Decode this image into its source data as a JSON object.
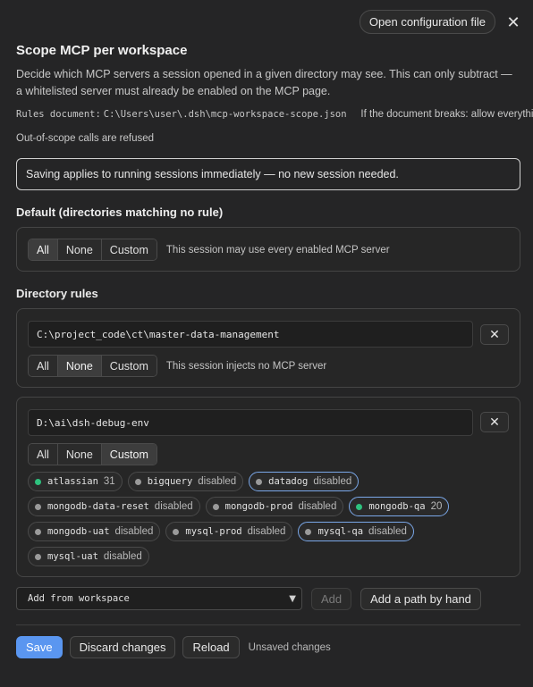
{
  "header": {
    "open_config_label": "Open configuration file",
    "close_glyph": "✕"
  },
  "title": "Scope MCP per workspace",
  "description": "Decide which MCP servers a session opened in a given directory may see. This can only subtract — a whitelisted server must already be enabled on the MCP page.",
  "rules": {
    "document_label": "Rules document:",
    "document_path": "C:\\Users\\user\\.dsh\\mcp-workspace-scope.json",
    "fallback": "If the document breaks: allow everything",
    "refused": "Out-of-scope calls are refused"
  },
  "notice": "Saving applies to running sessions immediately — no new session needed.",
  "default": {
    "heading": "Default (directories matching no rule)",
    "options": [
      "All",
      "None",
      "Custom"
    ],
    "selected": "All",
    "hint": "This session may use every enabled MCP server"
  },
  "rules_section": {
    "heading": "Directory rules",
    "items": [
      {
        "path": "C:\\project_code\\ct\\master-data-management",
        "options": [
          "All",
          "None",
          "Custom"
        ],
        "selected": "None",
        "hint": "This session injects no MCP server"
      },
      {
        "path": "D:\\ai\\dsh-debug-env",
        "options": [
          "All",
          "None",
          "Custom"
        ],
        "selected": "Custom",
        "chips": [
          [
            {
              "name": "atlassian",
              "status": "31",
              "enabled": true,
              "selected": false
            },
            {
              "name": "bigquery",
              "status": "disabled",
              "enabled": false,
              "selected": false
            },
            {
              "name": "datadog",
              "status": "disabled",
              "enabled": false,
              "selected": true
            }
          ],
          [
            {
              "name": "mongodb-data-reset",
              "status": "disabled",
              "enabled": false,
              "selected": false
            },
            {
              "name": "mongodb-prod",
              "status": "disabled",
              "enabled": false,
              "selected": false
            },
            {
              "name": "mongodb-qa",
              "status": "20",
              "enabled": true,
              "selected": true
            }
          ],
          [
            {
              "name": "mongodb-uat",
              "status": "disabled",
              "enabled": false,
              "selected": false
            },
            {
              "name": "mysql-prod",
              "status": "disabled",
              "enabled": false,
              "selected": false
            },
            {
              "name": "mysql-qa",
              "status": "disabled",
              "enabled": false,
              "selected": true
            }
          ],
          [
            {
              "name": "mysql-uat",
              "status": "disabled",
              "enabled": false,
              "selected": false
            }
          ]
        ]
      }
    ]
  },
  "add": {
    "select_value": "Add from workspace",
    "add_label": "Add",
    "add_path_label": "Add a path by hand"
  },
  "footer": {
    "save_label": "Save",
    "discard_label": "Discard changes",
    "reload_label": "Reload",
    "status": "Unsaved changes"
  },
  "colors": {
    "accent": "#5a96f0",
    "enabled_dot": "#2ec27e",
    "disabled_dot": "#9a9a9a",
    "selected_border": "#7aa7e8"
  }
}
